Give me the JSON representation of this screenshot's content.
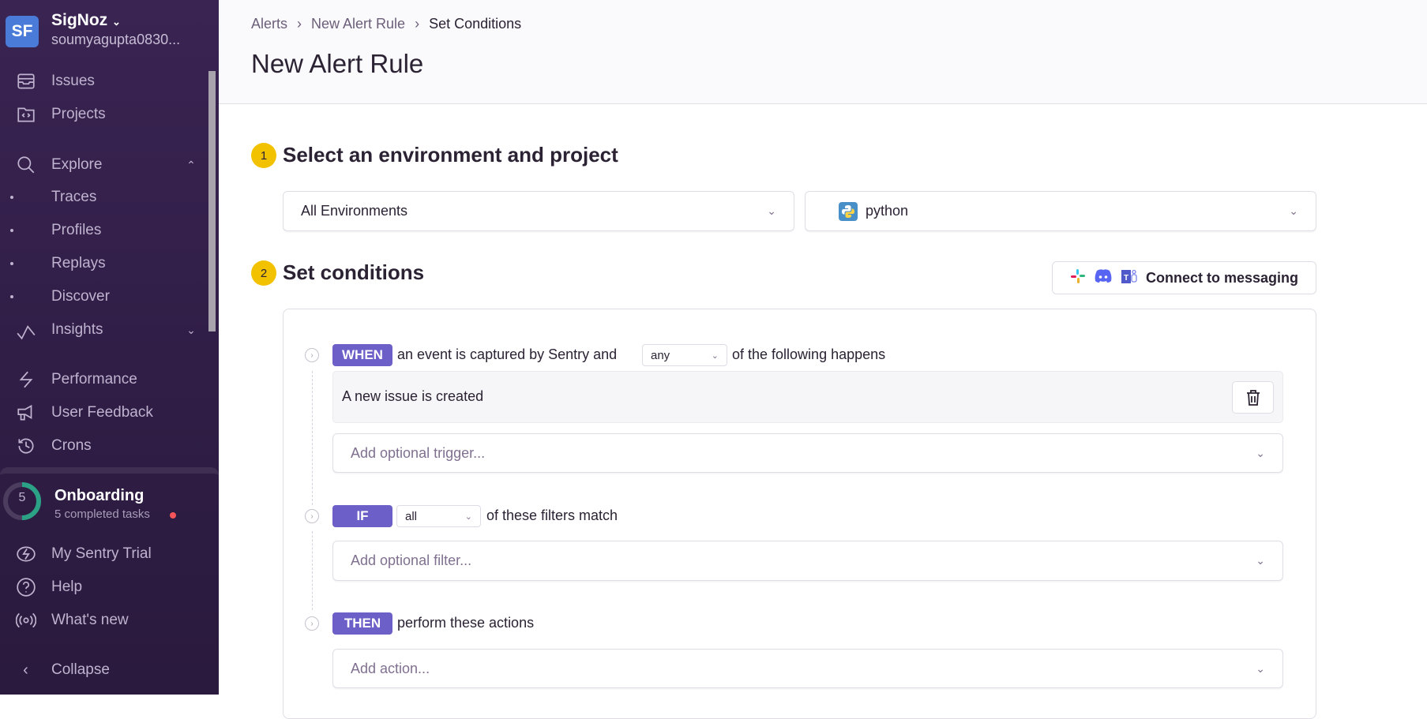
{
  "sidebar": {
    "avatar": "SF",
    "org": "SigNoz",
    "email": "soumyagupta0830...",
    "items": {
      "issues": "Issues",
      "projects": "Projects",
      "explore": "Explore",
      "traces": "Traces",
      "profiles": "Profiles",
      "replays": "Replays",
      "discover": "Discover",
      "insights": "Insights",
      "performance": "Performance",
      "feedback": "User Feedback",
      "crons": "Crons",
      "trial": "My Sentry Trial",
      "help": "Help",
      "whatsnew": "What's new",
      "collapse": "Collapse"
    },
    "onboarding": {
      "count": "5",
      "title": "Onboarding",
      "subtitle": "5 completed tasks",
      "progress": 0.5
    }
  },
  "breadcrumb": {
    "a": "Alerts",
    "b": "New Alert Rule",
    "c": "Set Conditions"
  },
  "title": "New Alert Rule",
  "section1": {
    "num": "1",
    "title": "Select an environment and project",
    "environment": "All Environments",
    "project": "python"
  },
  "section2": {
    "num": "2",
    "title": "Set conditions",
    "connect": "Connect to messaging",
    "when": {
      "badge": "WHEN",
      "text1": "an event is captured by Sentry and",
      "match": "any",
      "text2": "of the following happens",
      "condition": "A new issue is created",
      "trigger_placeholder": "Add optional trigger..."
    },
    "if": {
      "badge": "IF",
      "match": "all",
      "text": "of these filters match",
      "filter_placeholder": "Add optional filter..."
    },
    "then": {
      "badge": "THEN",
      "text": "perform these actions",
      "action_placeholder": "Add action..."
    }
  }
}
